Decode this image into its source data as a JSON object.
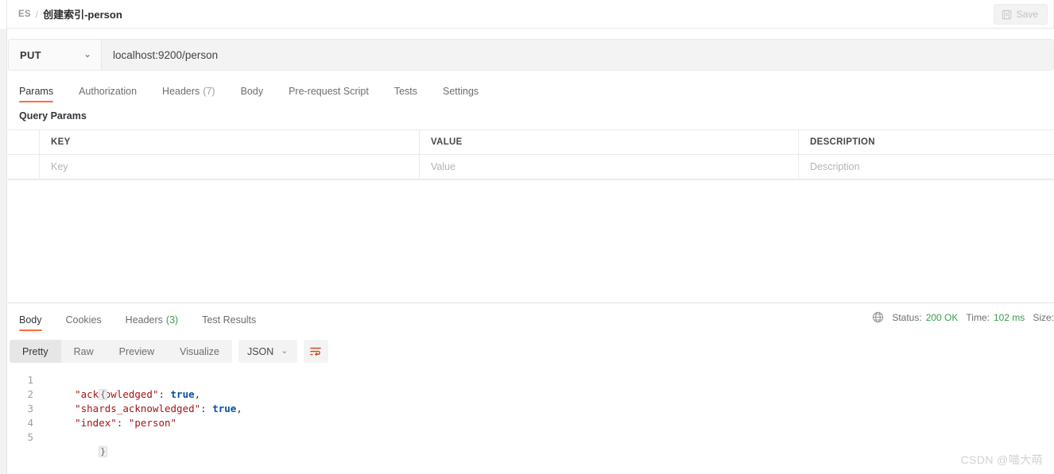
{
  "header": {
    "breadcrumb_root": "ES",
    "breadcrumb_separator": "/",
    "breadcrumb_current": "创建索引-person",
    "save_label": "Save",
    "save_icon": "floppy-disk-icon"
  },
  "request": {
    "method": "PUT",
    "method_caret": "⌄",
    "url": "localhost:9200/person",
    "tabs": [
      {
        "label": "Params",
        "count": "",
        "active": true
      },
      {
        "label": "Authorization",
        "count": "",
        "active": false
      },
      {
        "label": "Headers",
        "count": "(7)",
        "active": false
      },
      {
        "label": "Body",
        "count": "",
        "active": false
      },
      {
        "label": "Pre-request Script",
        "count": "",
        "active": false
      },
      {
        "label": "Tests",
        "count": "",
        "active": false
      },
      {
        "label": "Settings",
        "count": "",
        "active": false
      }
    ],
    "query_params_label": "Query Params",
    "table": {
      "columns": [
        "KEY",
        "VALUE",
        "DESCRIPTION"
      ],
      "placeholder_row": [
        "Key",
        "Value",
        "Description"
      ]
    }
  },
  "response": {
    "tabs": [
      {
        "label": "Body",
        "count": "",
        "active": true
      },
      {
        "label": "Cookies",
        "count": "",
        "active": false
      },
      {
        "label": "Headers",
        "count": "(3)",
        "active": false
      },
      {
        "label": "Test Results",
        "count": "",
        "active": false
      }
    ],
    "status": {
      "globe_icon": "globe-icon",
      "status_label": "Status:",
      "status_value": "200 OK",
      "time_label": "Time:",
      "time_value": "102 ms",
      "size_label": "Size:"
    },
    "view_modes": [
      {
        "label": "Pretty",
        "active": true
      },
      {
        "label": "Raw",
        "active": false
      },
      {
        "label": "Preview",
        "active": false
      },
      {
        "label": "Visualize",
        "active": false
      }
    ],
    "format_select": {
      "value": "JSON",
      "caret": "⌄"
    },
    "wrap_button_icon": "word-wrap-icon",
    "body_lines": [
      {
        "num": "1",
        "indent": 0,
        "fold": "{",
        "tokens": []
      },
      {
        "num": "2",
        "indent": 1,
        "fold": "",
        "tokens": [
          {
            "t": "key",
            "v": "\"acknowledged\""
          },
          {
            "t": "punc",
            "v": ": "
          },
          {
            "t": "bool",
            "v": "true"
          },
          {
            "t": "punc",
            "v": ","
          }
        ]
      },
      {
        "num": "3",
        "indent": 1,
        "fold": "",
        "tokens": [
          {
            "t": "key",
            "v": "\"shards_acknowledged\""
          },
          {
            "t": "punc",
            "v": ": "
          },
          {
            "t": "bool",
            "v": "true"
          },
          {
            "t": "punc",
            "v": ","
          }
        ]
      },
      {
        "num": "4",
        "indent": 1,
        "fold": "",
        "tokens": [
          {
            "t": "key",
            "v": "\"index\""
          },
          {
            "t": "punc",
            "v": ": "
          },
          {
            "t": "str",
            "v": "\"person\""
          }
        ]
      },
      {
        "num": "5",
        "indent": 0,
        "fold": "}",
        "tokens": []
      }
    ]
  },
  "watermark": "CSDN @喵大萌",
  "colors": {
    "accent": "#ff6c37",
    "status_green": "#3a9e4c",
    "json_key": "#a31515",
    "json_bool": "#0451a5",
    "panel_bg": "#f3f3f3"
  }
}
